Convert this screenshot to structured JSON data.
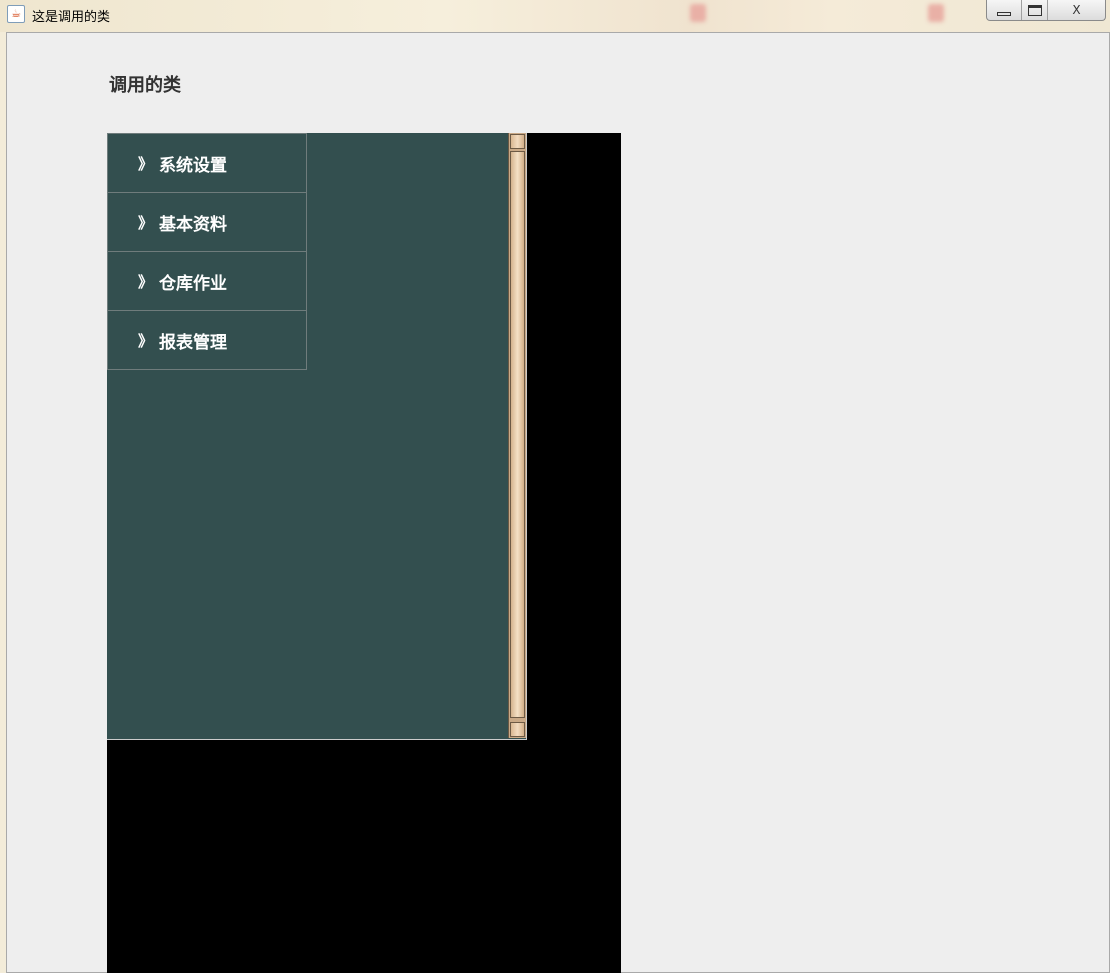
{
  "window": {
    "title": "这是调用的类",
    "icon": "java-coffee-icon",
    "buttons": [
      "minimize",
      "maximize",
      "close"
    ],
    "close_glyph": "X"
  },
  "content": {
    "heading": "调用的类"
  },
  "navigation": {
    "arrow": "》",
    "items": [
      {
        "label": "系统设置"
      },
      {
        "label": "基本资料"
      },
      {
        "label": "仓库作业"
      },
      {
        "label": "报表管理"
      }
    ]
  },
  "colors": {
    "panel_bg": "#334f4f",
    "scrollbar": "#c9a987",
    "frame_bg": "#eeeeee",
    "black_area": "#000000"
  }
}
